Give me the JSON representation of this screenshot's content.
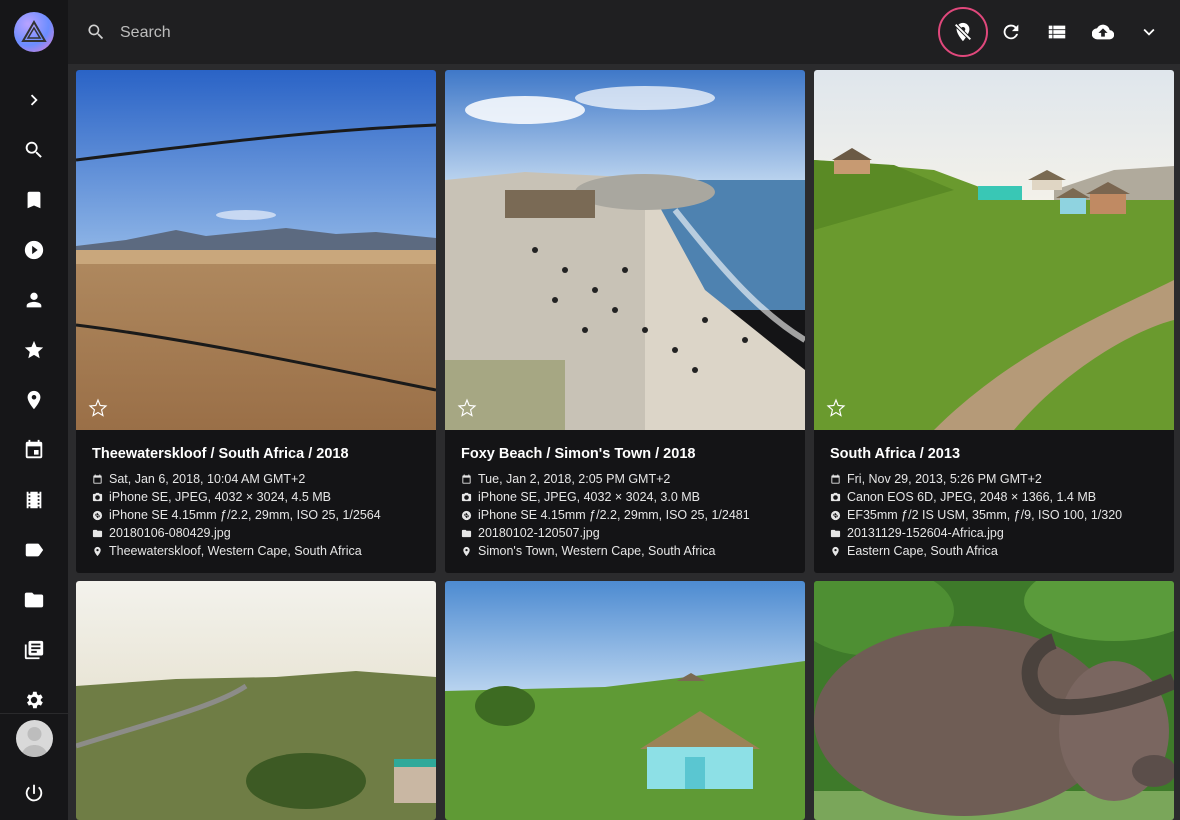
{
  "search": {
    "placeholder": "Search"
  },
  "cards": [
    {
      "title": "Theewaterskloof / South Africa / 2018",
      "date": "Sat, Jan 6, 2018, 10:04 AM GMT+2",
      "camera": "iPhone SE, JPEG, 4032 × 3024, 4.5 MB",
      "lens": "iPhone SE 4.15mm ƒ/2.2, 29mm, ISO 25, 1/2564",
      "file": "20180106-080429.jpg",
      "location": "Theewaterskloof, Western Cape, South Africa"
    },
    {
      "title": "Foxy Beach / Simon's Town / 2018",
      "date": "Tue, Jan 2, 2018, 2:05 PM GMT+2",
      "camera": "iPhone SE, JPEG, 4032 × 3024, 3.0 MB",
      "lens": "iPhone SE 4.15mm ƒ/2.2, 29mm, ISO 25, 1/2481",
      "file": "20180102-120507.jpg",
      "location": "Simon's Town, Western Cape, South Africa"
    },
    {
      "title": "South Africa / 2013",
      "date": "Fri, Nov 29, 2013, 5:26 PM GMT+2",
      "camera": "Canon EOS 6D, JPEG, 2048 × 1366, 1.4 MB",
      "lens": "EF35mm ƒ/2 IS USM, 35mm, ƒ/9, ISO 100, 1/320",
      "file": "20131129-152604-Africa.jpg",
      "location": "Eastern Cape, South Africa"
    }
  ],
  "icons": {
    "sidebar": [
      "chevron-right-icon",
      "search-icon",
      "bookmark-icon",
      "play-icon",
      "person-icon",
      "star-icon",
      "place-icon",
      "calendar-icon",
      "film-icon",
      "label-icon",
      "folder-icon",
      "library-icon",
      "settings-icon",
      "power-icon"
    ],
    "toolbar": [
      "location-off-icon",
      "refresh-icon",
      "list-view-icon",
      "cloud-upload-icon",
      "chevron-down-icon"
    ]
  },
  "colors": {
    "accent": "#e0487c",
    "sidebar": "#161618",
    "topbar": "#1f1f21",
    "background": "#2b2b2d"
  }
}
